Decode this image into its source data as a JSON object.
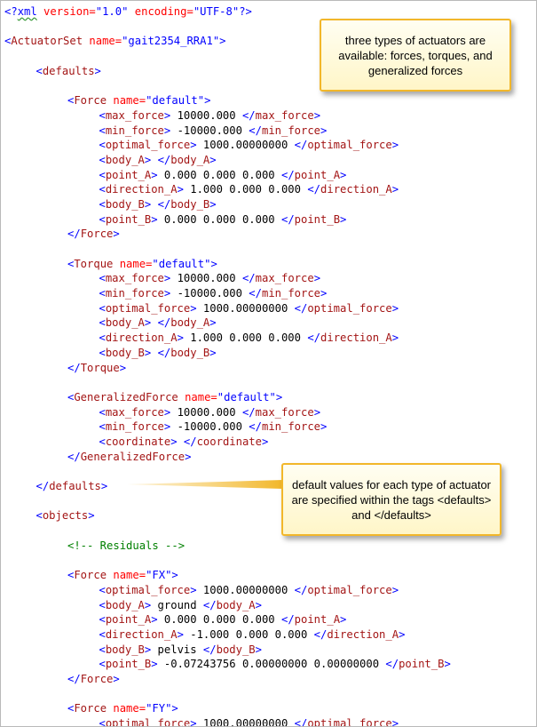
{
  "xml_lines": [
    {
      "indent": 0,
      "parts": [
        {
          "t": "<?",
          "c": "pi"
        },
        {
          "t": "xml",
          "c": "pi xmlword"
        },
        {
          "t": " version=",
          "c": "at"
        },
        {
          "t": "\"1.0\"",
          "c": "vl"
        },
        {
          "t": " encoding=",
          "c": "at"
        },
        {
          "t": "\"UTF-8\"",
          "c": "vl"
        },
        {
          "t": "?>",
          "c": "pi"
        }
      ]
    },
    {
      "indent": 0,
      "parts": []
    },
    {
      "indent": 0,
      "parts": [
        {
          "t": "<",
          "c": "br"
        },
        {
          "t": "ActuatorSet",
          "c": "tg"
        },
        {
          "t": " name=",
          "c": "at"
        },
        {
          "t": "\"gait2354_RRA1\"",
          "c": "vl"
        },
        {
          "t": ">",
          "c": "br"
        }
      ]
    },
    {
      "indent": 0,
      "parts": []
    },
    {
      "indent": 1,
      "parts": [
        {
          "t": "<",
          "c": "br"
        },
        {
          "t": "defaults",
          "c": "tg"
        },
        {
          "t": ">",
          "c": "br"
        }
      ]
    },
    {
      "indent": 0,
      "parts": []
    },
    {
      "indent": 2,
      "parts": [
        {
          "t": "<",
          "c": "br"
        },
        {
          "t": "Force",
          "c": "tg"
        },
        {
          "t": " name=",
          "c": "at"
        },
        {
          "t": "\"default\"",
          "c": "vl"
        },
        {
          "t": ">",
          "c": "br"
        }
      ]
    },
    {
      "indent": 3,
      "parts": [
        {
          "t": "<",
          "c": "br"
        },
        {
          "t": "max_force",
          "c": "tg"
        },
        {
          "t": ">",
          "c": "br"
        },
        {
          "t": " 10000.000 ",
          "c": "tx"
        },
        {
          "t": "</",
          "c": "br"
        },
        {
          "t": "max_force",
          "c": "tg"
        },
        {
          "t": ">",
          "c": "br"
        }
      ]
    },
    {
      "indent": 3,
      "parts": [
        {
          "t": "<",
          "c": "br"
        },
        {
          "t": "min_force",
          "c": "tg"
        },
        {
          "t": ">",
          "c": "br"
        },
        {
          "t": " -10000.000 ",
          "c": "tx"
        },
        {
          "t": "</",
          "c": "br"
        },
        {
          "t": "min_force",
          "c": "tg"
        },
        {
          "t": ">",
          "c": "br"
        }
      ]
    },
    {
      "indent": 3,
      "parts": [
        {
          "t": "<",
          "c": "br"
        },
        {
          "t": "optimal_force",
          "c": "tg"
        },
        {
          "t": ">",
          "c": "br"
        },
        {
          "t": " 1000.00000000 ",
          "c": "tx"
        },
        {
          "t": "</",
          "c": "br"
        },
        {
          "t": "optimal_force",
          "c": "tg"
        },
        {
          "t": ">",
          "c": "br"
        }
      ]
    },
    {
      "indent": 3,
      "parts": [
        {
          "t": "<",
          "c": "br"
        },
        {
          "t": "body_A",
          "c": "tg"
        },
        {
          "t": ">",
          "c": "br"
        },
        {
          "t": " ",
          "c": "tx"
        },
        {
          "t": "</",
          "c": "br"
        },
        {
          "t": "body_A",
          "c": "tg"
        },
        {
          "t": ">",
          "c": "br"
        }
      ]
    },
    {
      "indent": 3,
      "parts": [
        {
          "t": "<",
          "c": "br"
        },
        {
          "t": "point_A",
          "c": "tg"
        },
        {
          "t": ">",
          "c": "br"
        },
        {
          "t": " 0.000 0.000 0.000 ",
          "c": "tx"
        },
        {
          "t": "</",
          "c": "br"
        },
        {
          "t": "point_A",
          "c": "tg"
        },
        {
          "t": ">",
          "c": "br"
        }
      ]
    },
    {
      "indent": 3,
      "parts": [
        {
          "t": "<",
          "c": "br"
        },
        {
          "t": "direction_A",
          "c": "tg"
        },
        {
          "t": ">",
          "c": "br"
        },
        {
          "t": " 1.000 0.000 0.000 ",
          "c": "tx"
        },
        {
          "t": "</",
          "c": "br"
        },
        {
          "t": "direction_A",
          "c": "tg"
        },
        {
          "t": ">",
          "c": "br"
        }
      ]
    },
    {
      "indent": 3,
      "parts": [
        {
          "t": "<",
          "c": "br"
        },
        {
          "t": "body_B",
          "c": "tg"
        },
        {
          "t": ">",
          "c": "br"
        },
        {
          "t": " ",
          "c": "tx"
        },
        {
          "t": "</",
          "c": "br"
        },
        {
          "t": "body_B",
          "c": "tg"
        },
        {
          "t": ">",
          "c": "br"
        }
      ]
    },
    {
      "indent": 3,
      "parts": [
        {
          "t": "<",
          "c": "br"
        },
        {
          "t": "point_B",
          "c": "tg"
        },
        {
          "t": ">",
          "c": "br"
        },
        {
          "t": " 0.000 0.000 0.000 ",
          "c": "tx"
        },
        {
          "t": "</",
          "c": "br"
        },
        {
          "t": "point_B",
          "c": "tg"
        },
        {
          "t": ">",
          "c": "br"
        }
      ]
    },
    {
      "indent": 2,
      "parts": [
        {
          "t": "</",
          "c": "br"
        },
        {
          "t": "Force",
          "c": "tg"
        },
        {
          "t": ">",
          "c": "br"
        }
      ]
    },
    {
      "indent": 0,
      "parts": []
    },
    {
      "indent": 2,
      "parts": [
        {
          "t": "<",
          "c": "br"
        },
        {
          "t": "Torque",
          "c": "tg"
        },
        {
          "t": " name=",
          "c": "at"
        },
        {
          "t": "\"default\"",
          "c": "vl"
        },
        {
          "t": ">",
          "c": "br"
        }
      ]
    },
    {
      "indent": 3,
      "parts": [
        {
          "t": "<",
          "c": "br"
        },
        {
          "t": "max_force",
          "c": "tg"
        },
        {
          "t": ">",
          "c": "br"
        },
        {
          "t": " 10000.000 ",
          "c": "tx"
        },
        {
          "t": "</",
          "c": "br"
        },
        {
          "t": "max_force",
          "c": "tg"
        },
        {
          "t": ">",
          "c": "br"
        }
      ]
    },
    {
      "indent": 3,
      "parts": [
        {
          "t": "<",
          "c": "br"
        },
        {
          "t": "min_force",
          "c": "tg"
        },
        {
          "t": ">",
          "c": "br"
        },
        {
          "t": " -10000.000 ",
          "c": "tx"
        },
        {
          "t": "</",
          "c": "br"
        },
        {
          "t": "min_force",
          "c": "tg"
        },
        {
          "t": ">",
          "c": "br"
        }
      ]
    },
    {
      "indent": 3,
      "parts": [
        {
          "t": "<",
          "c": "br"
        },
        {
          "t": "optimal_force",
          "c": "tg"
        },
        {
          "t": ">",
          "c": "br"
        },
        {
          "t": " 1000.00000000 ",
          "c": "tx"
        },
        {
          "t": "</",
          "c": "br"
        },
        {
          "t": "optimal_force",
          "c": "tg"
        },
        {
          "t": ">",
          "c": "br"
        }
      ]
    },
    {
      "indent": 3,
      "parts": [
        {
          "t": "<",
          "c": "br"
        },
        {
          "t": "body_A",
          "c": "tg"
        },
        {
          "t": ">",
          "c": "br"
        },
        {
          "t": " ",
          "c": "tx"
        },
        {
          "t": "</",
          "c": "br"
        },
        {
          "t": "body_A",
          "c": "tg"
        },
        {
          "t": ">",
          "c": "br"
        }
      ]
    },
    {
      "indent": 3,
      "parts": [
        {
          "t": "<",
          "c": "br"
        },
        {
          "t": "direction_A",
          "c": "tg"
        },
        {
          "t": ">",
          "c": "br"
        },
        {
          "t": " 1.000 0.000 0.000 ",
          "c": "tx"
        },
        {
          "t": "</",
          "c": "br"
        },
        {
          "t": "direction_A",
          "c": "tg"
        },
        {
          "t": ">",
          "c": "br"
        }
      ]
    },
    {
      "indent": 3,
      "parts": [
        {
          "t": "<",
          "c": "br"
        },
        {
          "t": "body_B",
          "c": "tg"
        },
        {
          "t": ">",
          "c": "br"
        },
        {
          "t": " ",
          "c": "tx"
        },
        {
          "t": "</",
          "c": "br"
        },
        {
          "t": "body_B",
          "c": "tg"
        },
        {
          "t": ">",
          "c": "br"
        }
      ]
    },
    {
      "indent": 2,
      "parts": [
        {
          "t": "</",
          "c": "br"
        },
        {
          "t": "Torque",
          "c": "tg"
        },
        {
          "t": ">",
          "c": "br"
        }
      ]
    },
    {
      "indent": 0,
      "parts": []
    },
    {
      "indent": 2,
      "parts": [
        {
          "t": "<",
          "c": "br"
        },
        {
          "t": "GeneralizedForce",
          "c": "tg"
        },
        {
          "t": " name=",
          "c": "at"
        },
        {
          "t": "\"default\"",
          "c": "vl"
        },
        {
          "t": ">",
          "c": "br"
        }
      ]
    },
    {
      "indent": 3,
      "parts": [
        {
          "t": "<",
          "c": "br"
        },
        {
          "t": "max_force",
          "c": "tg"
        },
        {
          "t": ">",
          "c": "br"
        },
        {
          "t": " 10000.000 ",
          "c": "tx"
        },
        {
          "t": "</",
          "c": "br"
        },
        {
          "t": "max_force",
          "c": "tg"
        },
        {
          "t": ">",
          "c": "br"
        }
      ]
    },
    {
      "indent": 3,
      "parts": [
        {
          "t": "<",
          "c": "br"
        },
        {
          "t": "min_force",
          "c": "tg"
        },
        {
          "t": ">",
          "c": "br"
        },
        {
          "t": " -10000.000 ",
          "c": "tx"
        },
        {
          "t": "</",
          "c": "br"
        },
        {
          "t": "min_force",
          "c": "tg"
        },
        {
          "t": ">",
          "c": "br"
        }
      ]
    },
    {
      "indent": 3,
      "parts": [
        {
          "t": "<",
          "c": "br"
        },
        {
          "t": "coordinate",
          "c": "tg"
        },
        {
          "t": ">",
          "c": "br"
        },
        {
          "t": " ",
          "c": "tx"
        },
        {
          "t": "</",
          "c": "br"
        },
        {
          "t": "coordinate",
          "c": "tg"
        },
        {
          "t": ">",
          "c": "br"
        }
      ]
    },
    {
      "indent": 2,
      "parts": [
        {
          "t": "</",
          "c": "br"
        },
        {
          "t": "GeneralizedForce",
          "c": "tg"
        },
        {
          "t": ">",
          "c": "br"
        }
      ]
    },
    {
      "indent": 0,
      "parts": []
    },
    {
      "indent": 1,
      "parts": [
        {
          "t": "</",
          "c": "br"
        },
        {
          "t": "defaults",
          "c": "tg"
        },
        {
          "t": ">",
          "c": "br"
        }
      ]
    },
    {
      "indent": 0,
      "parts": []
    },
    {
      "indent": 1,
      "parts": [
        {
          "t": "<",
          "c": "br"
        },
        {
          "t": "objects",
          "c": "tg"
        },
        {
          "t": ">",
          "c": "br"
        }
      ]
    },
    {
      "indent": 0,
      "parts": []
    },
    {
      "indent": 2,
      "parts": [
        {
          "t": "<!-- Residuals -->",
          "c": "cm"
        }
      ]
    },
    {
      "indent": 0,
      "parts": []
    },
    {
      "indent": 2,
      "parts": [
        {
          "t": "<",
          "c": "br"
        },
        {
          "t": "Force",
          "c": "tg"
        },
        {
          "t": " name=",
          "c": "at"
        },
        {
          "t": "\"FX\"",
          "c": "vl"
        },
        {
          "t": ">",
          "c": "br"
        }
      ]
    },
    {
      "indent": 3,
      "parts": [
        {
          "t": "<",
          "c": "br"
        },
        {
          "t": "optimal_force",
          "c": "tg"
        },
        {
          "t": ">",
          "c": "br"
        },
        {
          "t": " 1000.00000000 ",
          "c": "tx"
        },
        {
          "t": "</",
          "c": "br"
        },
        {
          "t": "optimal_force",
          "c": "tg"
        },
        {
          "t": ">",
          "c": "br"
        }
      ]
    },
    {
      "indent": 3,
      "parts": [
        {
          "t": "<",
          "c": "br"
        },
        {
          "t": "body_A",
          "c": "tg"
        },
        {
          "t": ">",
          "c": "br"
        },
        {
          "t": " ground ",
          "c": "tx"
        },
        {
          "t": "</",
          "c": "br"
        },
        {
          "t": "body_A",
          "c": "tg"
        },
        {
          "t": ">",
          "c": "br"
        }
      ]
    },
    {
      "indent": 3,
      "parts": [
        {
          "t": "<",
          "c": "br"
        },
        {
          "t": "point_A",
          "c": "tg"
        },
        {
          "t": ">",
          "c": "br"
        },
        {
          "t": " 0.000 0.000 0.000 ",
          "c": "tx"
        },
        {
          "t": "</",
          "c": "br"
        },
        {
          "t": "point_A",
          "c": "tg"
        },
        {
          "t": ">",
          "c": "br"
        }
      ]
    },
    {
      "indent": 3,
      "parts": [
        {
          "t": "<",
          "c": "br"
        },
        {
          "t": "direction_A",
          "c": "tg"
        },
        {
          "t": ">",
          "c": "br"
        },
        {
          "t": " -1.000 0.000 0.000 ",
          "c": "tx"
        },
        {
          "t": "</",
          "c": "br"
        },
        {
          "t": "direction_A",
          "c": "tg"
        },
        {
          "t": ">",
          "c": "br"
        }
      ]
    },
    {
      "indent": 3,
      "parts": [
        {
          "t": "<",
          "c": "br"
        },
        {
          "t": "body_B",
          "c": "tg"
        },
        {
          "t": ">",
          "c": "br"
        },
        {
          "t": " pelvis ",
          "c": "tx"
        },
        {
          "t": "</",
          "c": "br"
        },
        {
          "t": "body_B",
          "c": "tg"
        },
        {
          "t": ">",
          "c": "br"
        }
      ]
    },
    {
      "indent": 3,
      "parts": [
        {
          "t": "<",
          "c": "br"
        },
        {
          "t": "point_B",
          "c": "tg"
        },
        {
          "t": ">",
          "c": "br"
        },
        {
          "t": " -0.07243756 0.00000000 0.00000000 ",
          "c": "tx"
        },
        {
          "t": "</",
          "c": "br"
        },
        {
          "t": "point_B",
          "c": "tg"
        },
        {
          "t": ">",
          "c": "br"
        }
      ]
    },
    {
      "indent": 2,
      "parts": [
        {
          "t": "</",
          "c": "br"
        },
        {
          "t": "Force",
          "c": "tg"
        },
        {
          "t": ">",
          "c": "br"
        }
      ]
    },
    {
      "indent": 0,
      "parts": []
    },
    {
      "indent": 2,
      "parts": [
        {
          "t": "<",
          "c": "br"
        },
        {
          "t": "Force",
          "c": "tg"
        },
        {
          "t": " name=",
          "c": "at"
        },
        {
          "t": "\"FY\"",
          "c": "vl"
        },
        {
          "t": ">",
          "c": "br"
        }
      ]
    },
    {
      "indent": 3,
      "parts": [
        {
          "t": "<",
          "c": "br"
        },
        {
          "t": "optimal_force",
          "c": "tg"
        },
        {
          "t": ">",
          "c": "br"
        },
        {
          "t": " 1000.00000000 ",
          "c": "tx"
        },
        {
          "t": "</",
          "c": "br"
        },
        {
          "t": "optimal_force",
          "c": "tg"
        },
        {
          "t": ">",
          "c": "br"
        }
      ]
    }
  ],
  "callouts": {
    "actuator_types": "three types of actuators are available:  forces, torques, and generalized forces",
    "defaults_info": "default values for each type of actuator are specified within the tags <defaults> and </defaults>"
  },
  "colors": {
    "bracket": "#0000ff",
    "tag_name": "#a31515",
    "attribute": "#ff0000",
    "value": "#0000ff",
    "comment": "#008000",
    "callout_border": "#f2b72a",
    "callout_fill": "#fff6c8"
  }
}
